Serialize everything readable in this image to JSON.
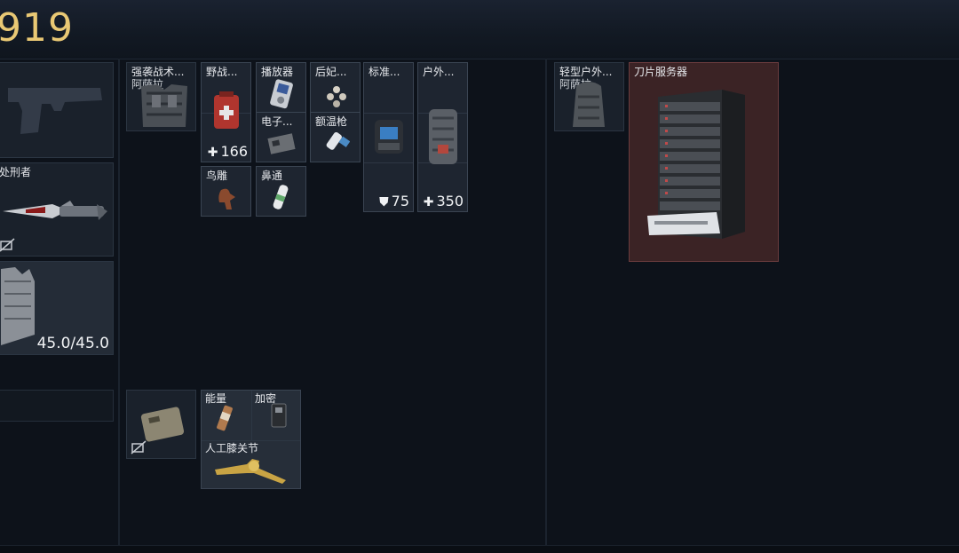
{
  "header": {
    "money": "919"
  },
  "equipment": {
    "pistol_slot": {},
    "melee": {
      "name": "处刑者",
      "status_icon": "no-insure-icon"
    },
    "armor": {
      "durability": "45.0/45.0"
    },
    "empty_slot": {},
    "pouch": {
      "status_icon": "no-insure-icon"
    }
  },
  "backpack": {
    "vest_item": {
      "name": "强袭战术...",
      "name2": "阿萨拉"
    },
    "items": [
      {
        "id": "field-kit",
        "name": "野战...",
        "stat": "166",
        "stat_icon": "plus"
      },
      {
        "id": "player",
        "name": "播放器"
      },
      {
        "id": "consort",
        "name": "后妃..."
      },
      {
        "id": "standard",
        "name": "标准...",
        "stat": "75",
        "stat_icon": "shield"
      },
      {
        "id": "outdoor",
        "name": "户外...",
        "stat": "350",
        "stat_icon": "plus"
      },
      {
        "id": "electronic",
        "name": "电子..."
      },
      {
        "id": "thermometer",
        "name": "额温枪"
      },
      {
        "id": "bird-carving",
        "name": "鸟雕"
      },
      {
        "id": "nasal",
        "name": "鼻通"
      }
    ],
    "pouch_items": [
      {
        "id": "energy",
        "name": "能量"
      },
      {
        "id": "encrypted",
        "name": "加密"
      },
      {
        "id": "knee",
        "name": "人工膝关节"
      }
    ]
  },
  "loot": {
    "backpack_item": {
      "name": "轻型户外...",
      "name2": "阿萨拉"
    },
    "server": {
      "name": "刀片服务器"
    }
  },
  "colors": {
    "money": "#e9c874",
    "highlight_red": "#3b2325"
  }
}
